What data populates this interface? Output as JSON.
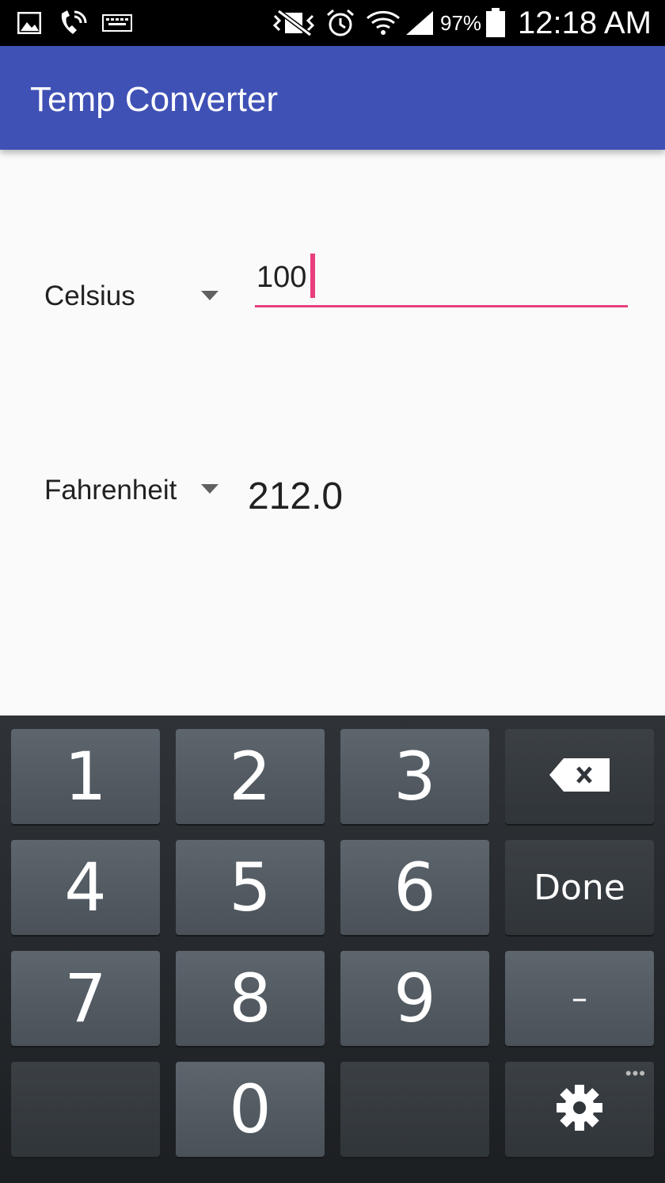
{
  "status_bar": {
    "icons": [
      "gallery-icon",
      "wifi-calling-icon",
      "keyboard-icon",
      "vibrate-icon",
      "alarm-icon",
      "wifi-icon",
      "signal-icon",
      "battery-icon"
    ],
    "battery_text": "97%",
    "time": "12:18 AM"
  },
  "app_bar": {
    "title": "Temp Converter",
    "color": "#3f51b5"
  },
  "converter": {
    "from_unit": "Celsius",
    "from_value": "100",
    "to_unit": "Fahrenheit",
    "to_value": "212.0",
    "accent_color": "#e83f7e"
  },
  "keyboard": {
    "keys": {
      "k1": "1",
      "k2": "2",
      "k3": "3",
      "k4": "4",
      "k5": "5",
      "k6": "6",
      "k7": "7",
      "k8": "8",
      "k9": "9",
      "k0": "0",
      "done": "Done",
      "minus": "–",
      "more": "•••"
    }
  }
}
